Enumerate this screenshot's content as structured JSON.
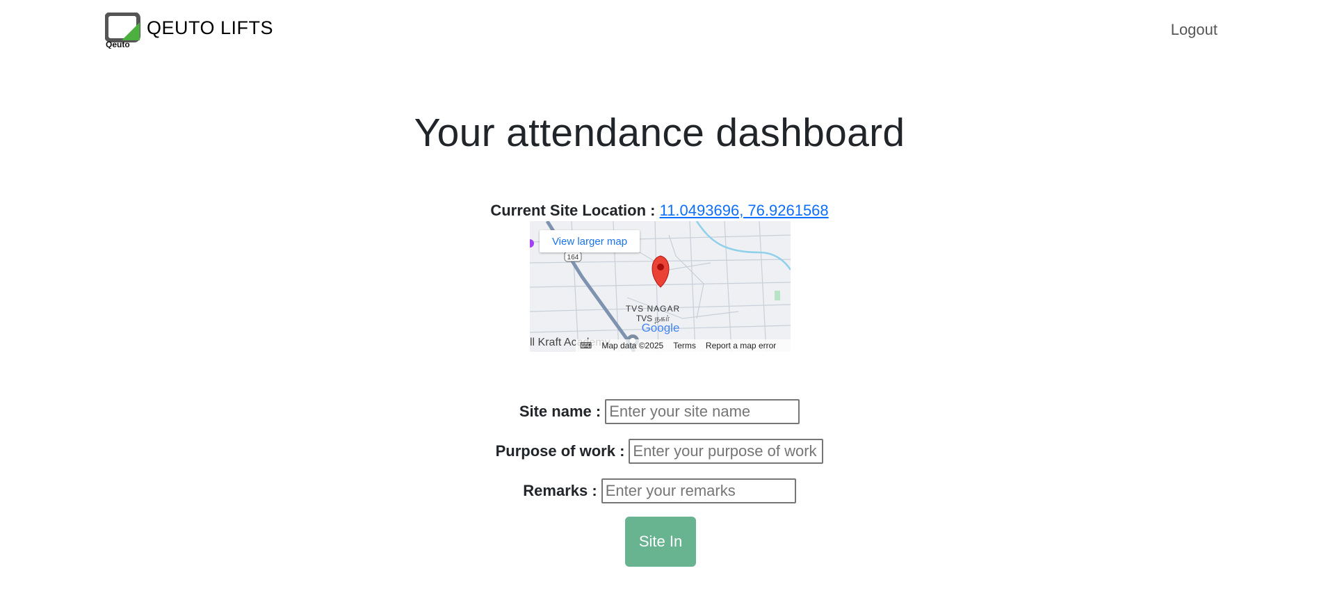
{
  "nav": {
    "logo_caption": "Qeuto",
    "brand": "QEUTO LIFTS",
    "logout": "Logout"
  },
  "page": {
    "title": "Your attendance dashboard"
  },
  "location": {
    "label": "Current Site Location :",
    "coords": "11.0493696, 76.9261568"
  },
  "map": {
    "view_larger": "View larger map",
    "area_en": "TVS NAGAR",
    "area_ta": "TVS நகர்",
    "road_badge": "164",
    "academy": "ll Kraft Academy",
    "google": "Google",
    "map_data": "Map data ©2025",
    "terms": "Terms",
    "report": "Report a map error"
  },
  "form": {
    "site_label": "Site name :",
    "site_placeholder": "Enter your site name",
    "purpose_label": "Purpose of work :",
    "purpose_placeholder": "Enter your purpose of work",
    "remarks_label": "Remarks :",
    "remarks_placeholder": "Enter your remarks",
    "submit": "Site In"
  },
  "colors": {
    "button": "#68b390",
    "link": "#0d6efd",
    "pin": "#ea4335"
  }
}
